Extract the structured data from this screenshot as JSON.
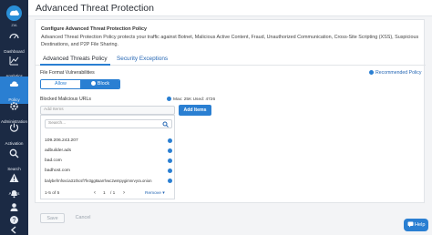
{
  "sidebar": {
    "brand": "ZIA",
    "items": [
      {
        "label": "Dashboard",
        "icon": "dashboard-icon"
      },
      {
        "label": "Analytics",
        "icon": "analytics-icon"
      },
      {
        "label": "Policy",
        "icon": "cloud-icon"
      },
      {
        "label": "Administration",
        "icon": "gear-icon"
      },
      {
        "label": "Activation",
        "icon": "activation-icon"
      },
      {
        "label": "Search",
        "icon": "search-icon"
      },
      {
        "label": "Alerts",
        "icon": "alert-icon"
      }
    ]
  },
  "header": {
    "title": "Advanced Threat Protection"
  },
  "config": {
    "title": "Configure Advanced Threat Protection Policy",
    "description": "Advanced Threat Protection Policy protects your traffic against Botnet, Malicious Active Content, Fraud, Unauthorized Communication, Cross-Site Scripting (XSS), Suspicious Destinations, and P2P File Sharing."
  },
  "tabs": [
    {
      "label": "Advanced Threats Policy"
    },
    {
      "label": "Security Exceptions"
    }
  ],
  "vuln": {
    "label": "File Format Vulnerabilities",
    "allow": "Allow",
    "block": "Block",
    "recommended": "Recommended Policy"
  },
  "blocked": {
    "label": "Blocked Malicious URLs",
    "max_used": "Max: 25K  Used: 4726",
    "add_placeholder": "Add Items",
    "add_button": "Add Items",
    "search_placeholder": "Search...",
    "urls": [
      "109.206.243.207",
      "adbuilder.ads",
      "bad.com",
      "badhost.com",
      "balybefrnfsvcia31thcsf7fe3gg8aarrhwc2wmpygimnrvyra.onion"
    ],
    "pager": {
      "range": "1-5 of 5",
      "page": "1",
      "of": "/ 1",
      "remove": "Remove"
    }
  },
  "footer": {
    "save": "Save",
    "cancel": "Cancel"
  },
  "help": {
    "label": "Help"
  }
}
